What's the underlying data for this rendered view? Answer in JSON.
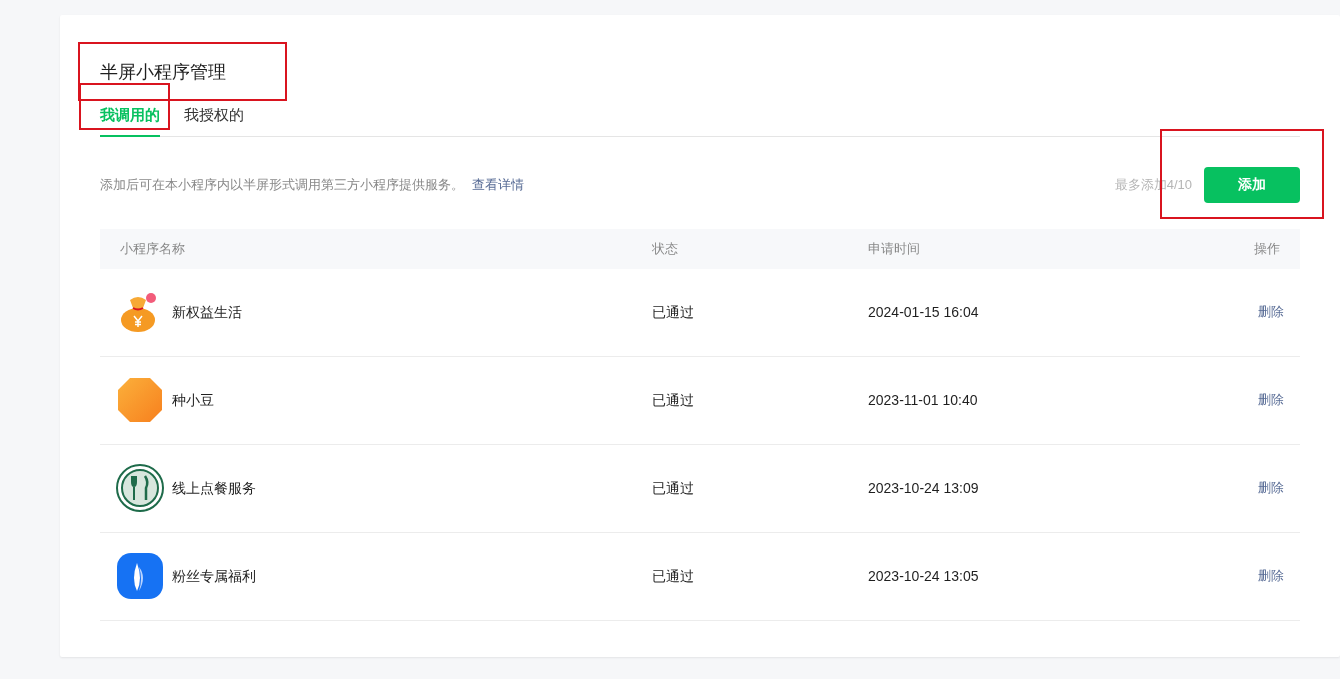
{
  "page": {
    "title": "半屏小程序管理",
    "highlighted": true
  },
  "tabs": [
    {
      "label": "我调用的",
      "selected": true,
      "highlighted": true
    },
    {
      "label": "我授权的",
      "selected": false,
      "highlighted": false
    }
  ],
  "description": {
    "text": "添加后可在本小程序内以半屏形式调用第三方小程序提供服务。",
    "link": "查看详情"
  },
  "limit": "最多添加4/10",
  "add_button": {
    "label": "添加",
    "highlighted": true
  },
  "table": {
    "columns": [
      "小程序名称",
      "状态",
      "申请时间",
      "操作"
    ],
    "rows": [
      {
        "name": "新权益生活",
        "status": "已通过",
        "time": "2024-01-15 16:04",
        "action": "删除"
      },
      {
        "name": "种小豆",
        "status": "已通过",
        "time": "2023-11-01 10:40",
        "action": "删除"
      },
      {
        "name": "线上点餐服务",
        "status": "已通过",
        "time": "2023-10-24 13:09",
        "action": "删除"
      },
      {
        "name": "粉丝专属福利",
        "status": "已通过",
        "time": "2023-10-24 13:05",
        "action": "删除"
      }
    ]
  }
}
